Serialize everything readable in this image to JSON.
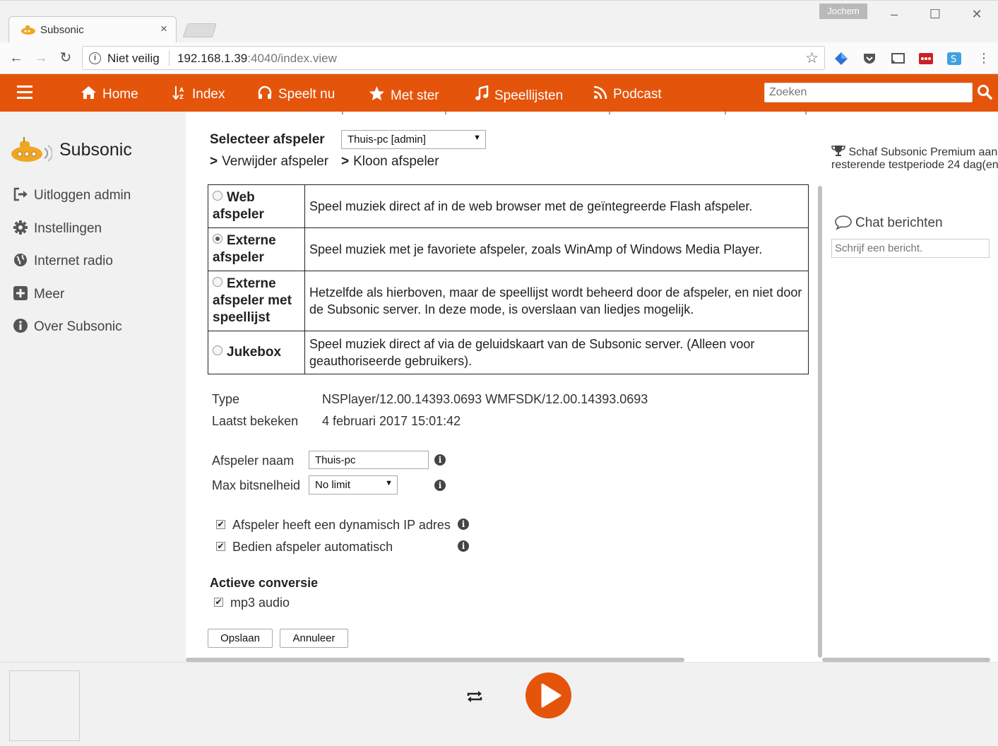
{
  "browser": {
    "tab_title": "Subsonic",
    "tab_close": "×",
    "user_badge": "Jochem",
    "security_label": "Niet veilig",
    "url_host": "192.168.1.39",
    "url_rest": ":4040/index.view"
  },
  "topnav": {
    "items": [
      {
        "label": "Home",
        "icon": "home-icon"
      },
      {
        "label": "Index",
        "icon": "sort-az-icon"
      },
      {
        "label": "Speelt nu",
        "icon": "headphones-icon"
      },
      {
        "label": "Met ster",
        "icon": "star-icon"
      },
      {
        "label": "Speellijsten",
        "icon": "music-note-icon"
      },
      {
        "label": "Podcast",
        "icon": "rss-icon"
      }
    ],
    "search_placeholder": "Zoeken",
    "accent_color": "#e5540b"
  },
  "sidebar": {
    "app_name": "Subsonic",
    "items": [
      {
        "label": "Uitloggen admin",
        "icon": "sign-out-icon"
      },
      {
        "label": "Instellingen",
        "icon": "gear-icon"
      },
      {
        "label": "Internet radio",
        "icon": "globe-icon"
      },
      {
        "label": "Meer",
        "icon": "plus-square-icon"
      },
      {
        "label": "Over Subsonic",
        "icon": "info-circle-icon"
      }
    ]
  },
  "main": {
    "select_player_label": "Selecteer afspeler",
    "select_player_value": "Thuis-pc [admin]",
    "remove_player": "Verwijder afspeler",
    "clone_player": "Kloon afspeler",
    "player_options": [
      {
        "label": "Web afspeler",
        "selected": false,
        "description": "Speel muziek direct af in de web browser met de geïntegreerde Flash afspeler."
      },
      {
        "label": "Externe afspeler",
        "selected": true,
        "description": "Speel muziek met je favoriete afspeler, zoals WinAmp of Windows Media Player."
      },
      {
        "label": "Externe afspeler met speellijst",
        "selected": false,
        "description": "Hetzelfde als hierboven, maar de speellijst wordt beheerd door de afspeler, en niet door de Subsonic server. In deze mode, is overslaan van liedjes mogelijk."
      },
      {
        "label": "Jukebox",
        "selected": false,
        "description": "Speel muziek direct af via de geluidskaart van de Subsonic server. (Alleen voor geauthoriseerde gebruikers)."
      }
    ],
    "type_label": "Type",
    "type_value": "NSPlayer/12.00.14393.0693 WMFSDK/12.00.14393.0693",
    "last_seen_label": "Laatst bekeken",
    "last_seen_value": "4 februari 2017 15:01:42",
    "player_name_label": "Afspeler naam",
    "player_name_value": "Thuis-pc",
    "max_bitrate_label": "Max bitsnelheid",
    "max_bitrate_value": "No limit",
    "dynamic_ip_label": "Afspeler heeft een dynamisch IP adres",
    "dynamic_ip_checked": true,
    "auto_control_label": "Bedien afspeler automatisch",
    "auto_control_checked": true,
    "active_conversion_title": "Actieve conversie",
    "mp3_label": "mp3 audio",
    "mp3_checked": true,
    "save_label": "Opslaan",
    "cancel_label": "Annuleer"
  },
  "right_panel": {
    "premium_line1": "Schaf Subsonic Premium aan",
    "premium_line2": "resterende testperiode 24 dag(en",
    "chat_title": "Chat berichten",
    "chat_placeholder": "Schrijf een bericht."
  }
}
